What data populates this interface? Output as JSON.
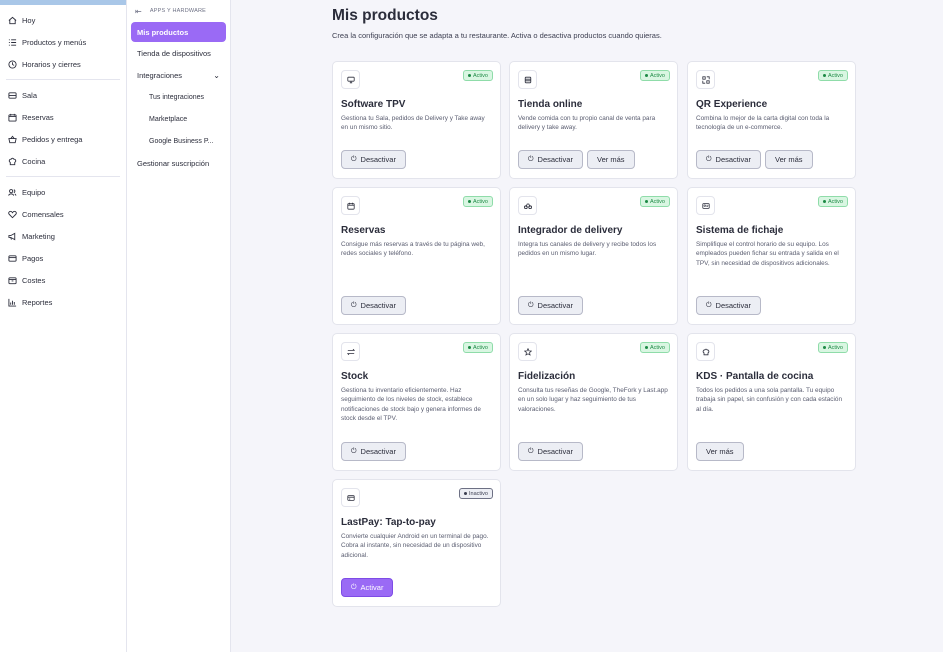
{
  "nav": {
    "groups": [
      [
        {
          "label": "Hoy",
          "icon": "home-icon"
        },
        {
          "label": "Productos y menús",
          "icon": "list-icon"
        },
        {
          "label": "Horarios y cierres",
          "icon": "clock-icon"
        }
      ],
      [
        {
          "label": "Sala",
          "icon": "table-icon"
        },
        {
          "label": "Reservas",
          "icon": "calendar-icon"
        },
        {
          "label": "Pedidos y entrega",
          "icon": "basket-icon"
        },
        {
          "label": "Cocina",
          "icon": "chef-hat-icon"
        }
      ],
      [
        {
          "label": "Equipo",
          "icon": "users-icon"
        },
        {
          "label": "Comensales",
          "icon": "heart-icon"
        },
        {
          "label": "Marketing",
          "icon": "megaphone-icon"
        },
        {
          "label": "Pagos",
          "icon": "card-icon"
        },
        {
          "label": "Costes",
          "icon": "box-icon"
        },
        {
          "label": "Reportes",
          "icon": "bar-chart-icon"
        }
      ]
    ]
  },
  "subnav": {
    "header": "APPS Y HARDWARE",
    "items": [
      {
        "label": "Mis productos",
        "active": true
      },
      {
        "label": "Tienda de dispositivos"
      },
      {
        "label": "Integraciones",
        "chevron": "⌄"
      },
      {
        "label": "Tus integraciones",
        "child": true
      },
      {
        "label": "Marketplace",
        "child": true
      },
      {
        "label": "Google Business P...",
        "child": true
      },
      {
        "label": "Gestionar suscripción"
      }
    ]
  },
  "page": {
    "title": "Mis productos",
    "subtitle": "Crea la configuración que se adapta a tu restaurante. Activa o desactiva productos cuando quieras."
  },
  "colors": {
    "accent": "#9a6af5",
    "active_badge_bg": "#d9f6e2",
    "active_badge_text": "#1d8a45"
  },
  "products": [
    {
      "title": "Software TPV",
      "icon": "monitor-icon",
      "status": "Activo",
      "active": true,
      "desc": "Gestiona tu Sala, pedidos de Delivery y Take away en un mismo sitio.",
      "buttons": [
        {
          "label": "Desactivar",
          "power": true
        }
      ]
    },
    {
      "title": "Tienda online",
      "icon": "store-icon",
      "status": "Activo",
      "active": true,
      "desc": "Vende comida con tu propio canal de venta para delivery y take away.",
      "buttons": [
        {
          "label": "Desactivar",
          "power": true
        },
        {
          "label": "Ver más"
        }
      ]
    },
    {
      "title": "QR Experience",
      "icon": "qr-icon",
      "status": "Activo",
      "active": true,
      "desc": "Combina lo mejor de la carta digital con toda la tecnología de un e-commerce.",
      "buttons": [
        {
          "label": "Desactivar",
          "power": true
        },
        {
          "label": "Ver más"
        }
      ]
    },
    {
      "title": "Reservas",
      "icon": "calendar-icon",
      "status": "Activo",
      "active": true,
      "desc": "Consigue más reservas a través de tu página web, redes sociales y teléfono.",
      "buttons": [
        {
          "label": "Desactivar",
          "power": true
        }
      ]
    },
    {
      "title": "Integrador de delivery",
      "icon": "bike-icon",
      "status": "Activo",
      "active": true,
      "desc": "Integra tus canales de delivery y recibe todos los pedidos en un mismo lugar.",
      "buttons": [
        {
          "label": "Desactivar",
          "power": true
        }
      ]
    },
    {
      "title": "Sistema de fichaje",
      "icon": "id-card-icon",
      "status": "Activo",
      "active": true,
      "desc": "Simplifique el control horario de su equipo. Los empleados pueden fichar su entrada y salida en el TPV, sin necesidad de dispositivos adicionales.",
      "buttons": [
        {
          "label": "Desactivar",
          "power": true
        }
      ]
    },
    {
      "title": "Stock",
      "icon": "arrows-icon",
      "status": "Activo",
      "active": true,
      "desc": "Gestiona tu inventario eficientemente. Haz seguimiento de los niveles de stock, establece notificaciones de stock bajo y genera informes de stock desde el TPV.",
      "buttons": [
        {
          "label": "Desactivar",
          "power": true
        }
      ]
    },
    {
      "title": "Fidelización",
      "icon": "star-icon",
      "status": "Activo",
      "active": true,
      "desc": "Consulta tus reseñas de Google, TheFork y Last.app en un solo lugar y haz seguimiento de tus valoraciones.",
      "buttons": [
        {
          "label": "Desactivar",
          "power": true
        }
      ]
    },
    {
      "title": "KDS · Pantalla de cocina",
      "icon": "chef-hat-icon",
      "status": "Activo",
      "active": true,
      "desc": "Todos los pedidos a una sola pantalla. Tu equipo trabaja sin papel, sin confusión y con cada estación al día.",
      "buttons": [
        {
          "label": "Ver más"
        }
      ]
    },
    {
      "title": "LastPay: Tap-to-pay",
      "icon": "credit-card-icon",
      "status": "Inactivo",
      "active": false,
      "desc": "Convierte cualquier Android en un terminal de pago. Cobra al instante, sin necesidad de un dispositivo adicional.",
      "buttons": [
        {
          "label": "Activar",
          "power": true,
          "primary": true
        }
      ]
    }
  ]
}
